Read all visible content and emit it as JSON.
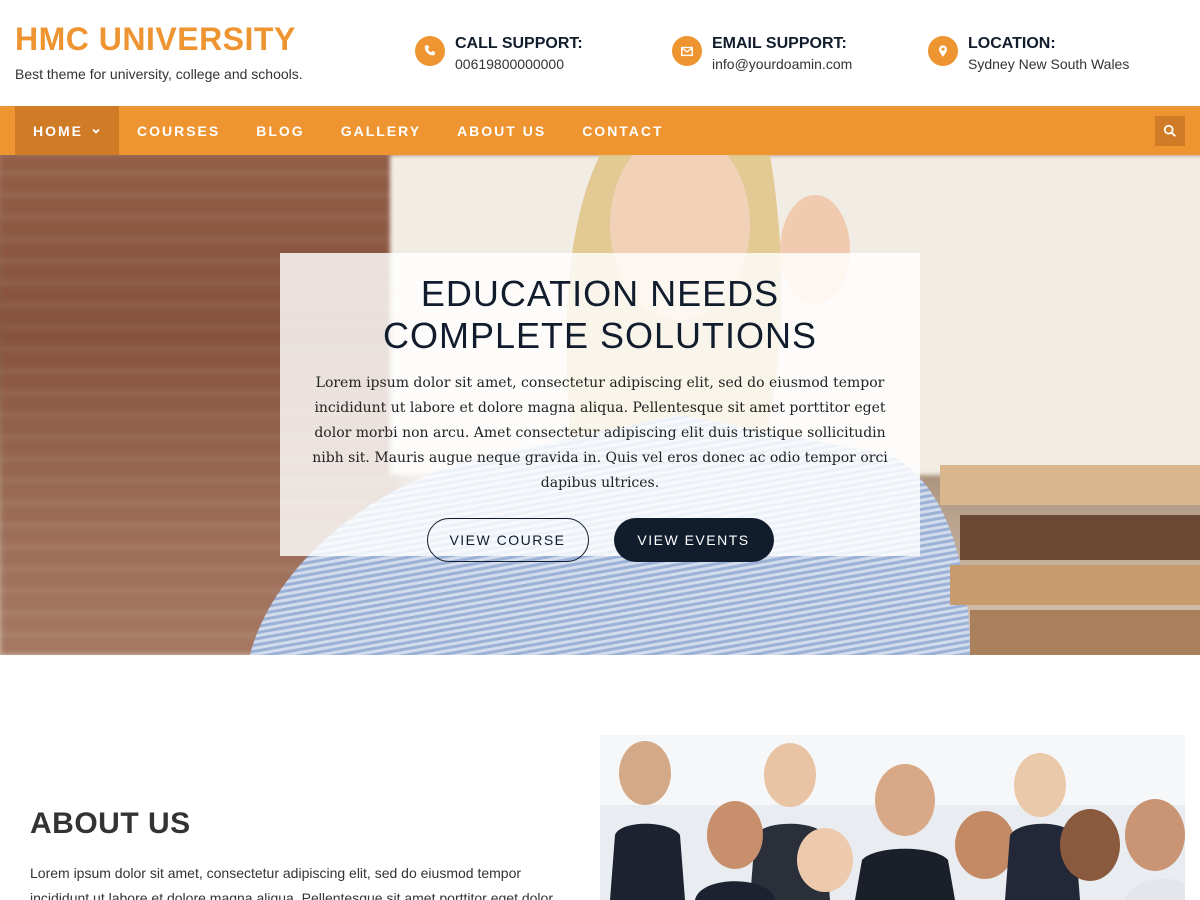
{
  "header": {
    "title": "HMC UNIVERSITY",
    "tagline": "Best theme for university, college and schools.",
    "contacts": [
      {
        "icon": "phone-icon",
        "title": "CALL SUPPORT:",
        "value": "00619800000000"
      },
      {
        "icon": "envelope-icon",
        "title": "EMAIL SUPPORT:",
        "value": "info@yourdoamin.com"
      },
      {
        "icon": "map-pin-icon",
        "title": "LOCATION:",
        "value": "Sydney New South Wales"
      }
    ]
  },
  "nav": {
    "items": [
      {
        "label": "HOME",
        "active": true
      },
      {
        "label": "COURSES"
      },
      {
        "label": "BLOG"
      },
      {
        "label": "GALLERY"
      },
      {
        "label": "ABOUT US"
      },
      {
        "label": "CONTACT"
      }
    ],
    "search_icon": "search-icon"
  },
  "hero": {
    "title": "EDUCATION NEEDS COMPLETE SOLUTIONS",
    "text": "Lorem ipsum dolor sit amet, consectetur adipiscing elit, sed do eiusmod tempor incididunt ut labore et dolore magna aliqua. Pellentesque sit amet porttitor eget dolor morbi non arcu. Amet consectetur adipiscing elit duis tristique sollicitudin nibh sit. Mauris augue neque gravida in. Quis vel eros donec ac odio tempor orci dapibus ultrices.",
    "button_primary": "VIEW COURSE",
    "button_secondary": "VIEW EVENTS"
  },
  "about": {
    "title": "ABOUT US",
    "text": "Lorem ipsum dolor sit amet, consectetur adipiscing elit, sed do eiusmod tempor incididunt ut labore et dolore magna aliqua. Pellentesque sit amet porttitor eget dolor"
  },
  "colors": {
    "accent": "#ee9431",
    "accent_dark": "#d07c26",
    "navy": "#111c2d"
  }
}
